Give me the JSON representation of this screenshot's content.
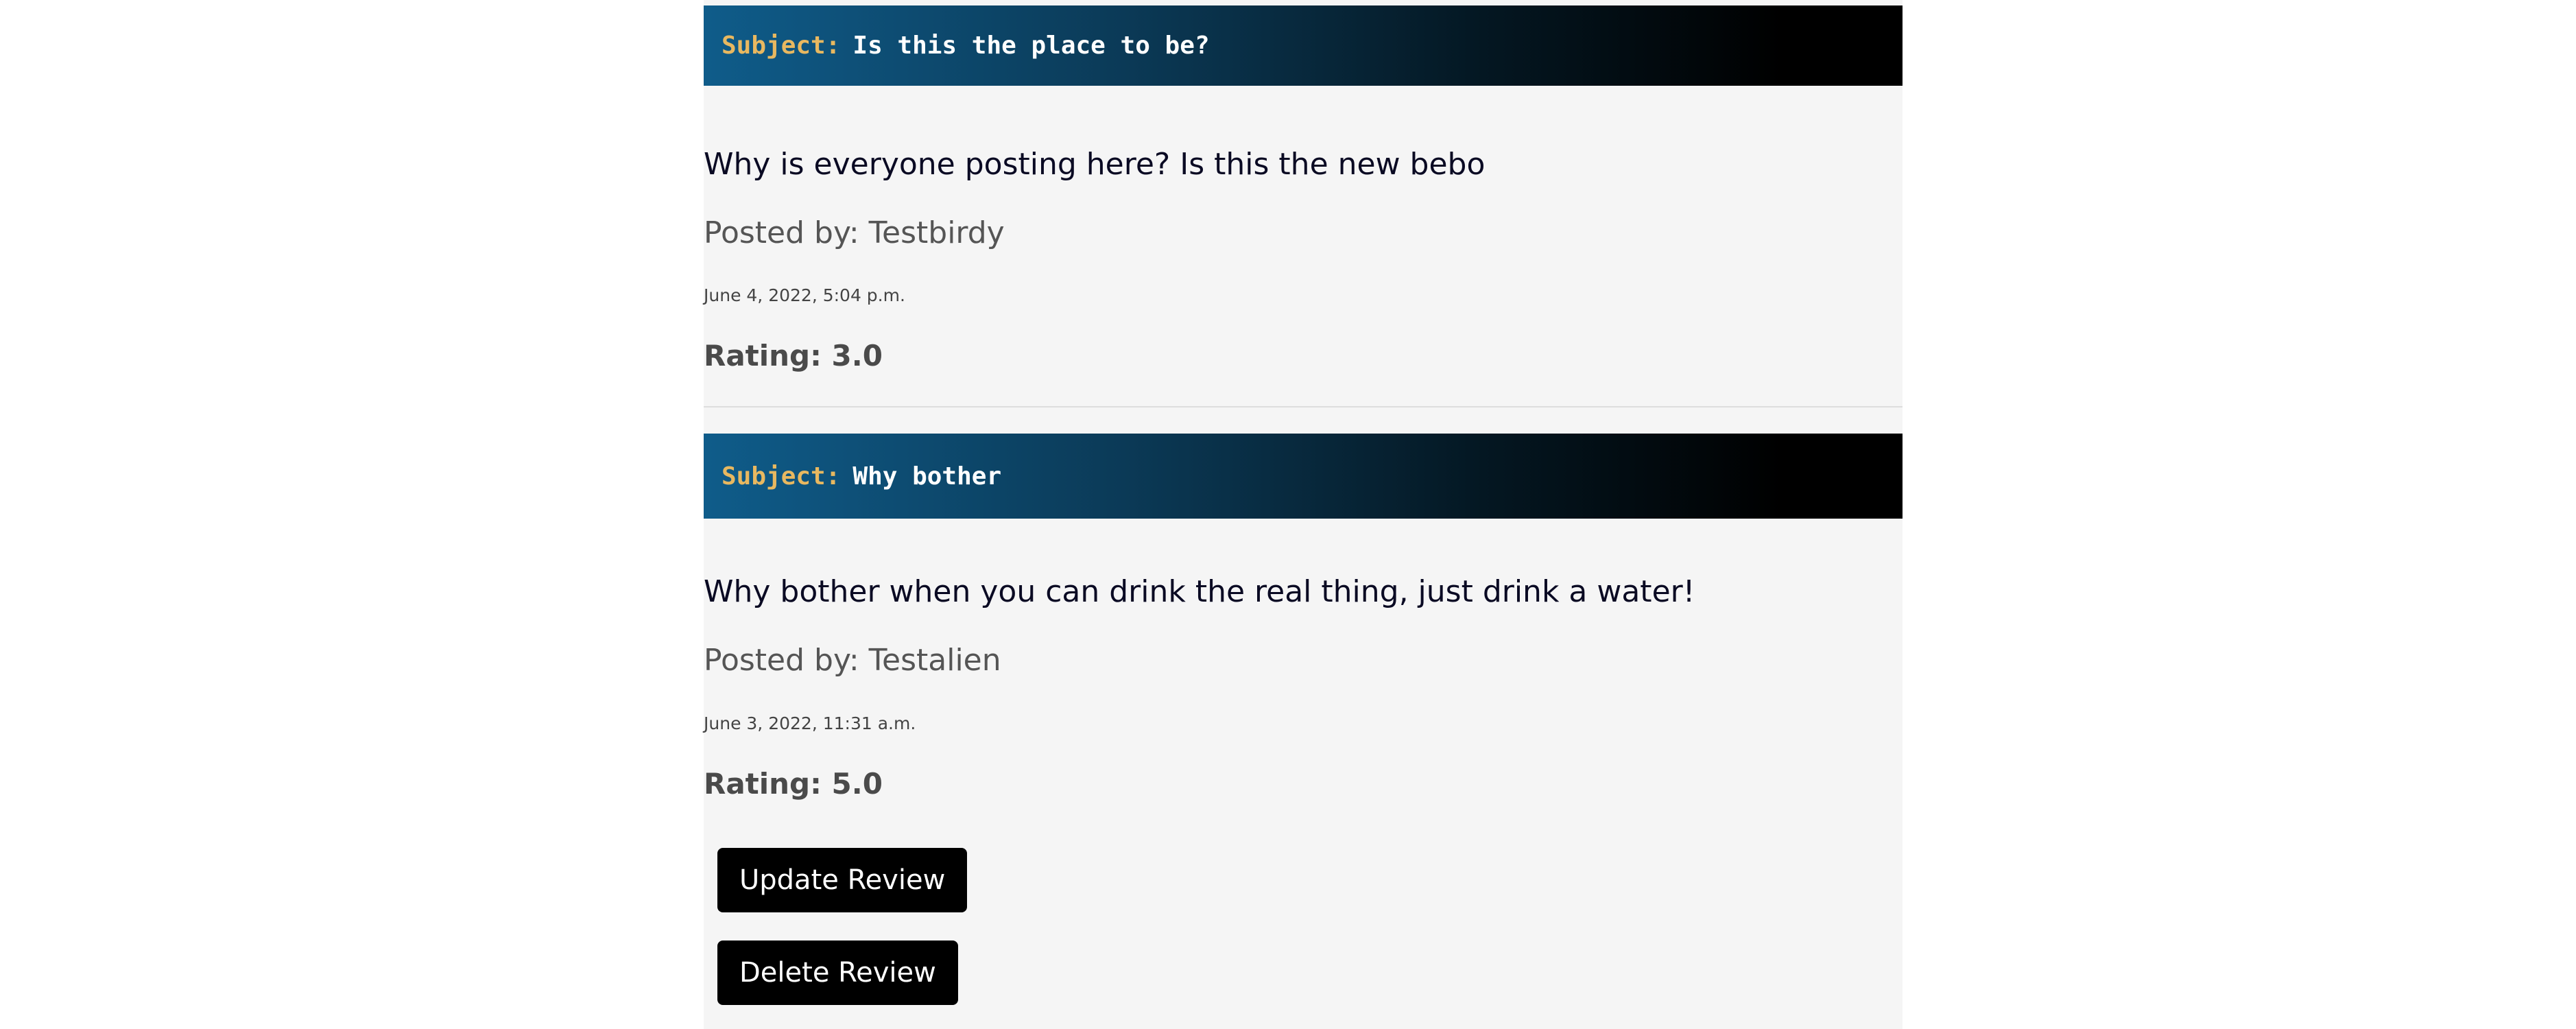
{
  "reviews": [
    {
      "subject_label": "Subject:",
      "subject": "Is this the place to be?",
      "body": "Why is everyone posting here? Is this the new bebo",
      "posted_by": "Posted by: Testbirdy",
      "date": "June 4, 2022, 5:04 p.m.",
      "rating": "Rating: 3.0"
    },
    {
      "subject_label": "Subject:",
      "subject": "Why bother",
      "body": "Why bother when you can drink the real thing, just drink a water!",
      "posted_by": "Posted by: Testalien",
      "date": "June 3, 2022, 11:31 a.m.",
      "rating": "Rating: 5.0",
      "update_label": "Update Review",
      "delete_label": "Delete Review"
    }
  ],
  "colors": {
    "subject_label": "#e8b860",
    "button_bg": "#000000",
    "panel_bg": "#f5f5f5"
  }
}
